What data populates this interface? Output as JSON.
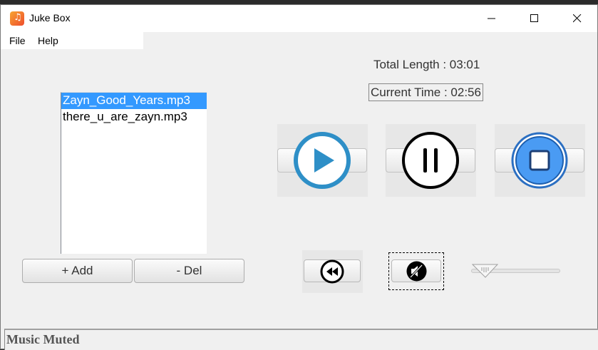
{
  "window": {
    "title": "Juke Box",
    "minimize_icon": "minimize-icon",
    "maximize_icon": "maximize-icon",
    "close_icon": "close-icon"
  },
  "menu": {
    "items": [
      {
        "label": "File"
      },
      {
        "label": "Help"
      }
    ]
  },
  "playlist": {
    "items": [
      {
        "label": "Zayn_Good_Years.mp3",
        "selected": true
      },
      {
        "label": "there_u_are_zayn.mp3",
        "selected": false
      }
    ]
  },
  "buttons": {
    "add": "+ Add",
    "delete": "- Del"
  },
  "info": {
    "total_length": "Total Length : 03:01",
    "current_time": "Current Time : 02:56"
  },
  "controls": {
    "play_icon": "play-icon",
    "pause_icon": "pause-icon",
    "stop_icon": "stop-icon",
    "rewind_icon": "rewind-icon",
    "mute_icon": "mute-icon",
    "volume_level": 0.0
  },
  "status": {
    "text": "Music Muted"
  },
  "colors": {
    "accent": "#2e8fc7",
    "selection": "#3399ff",
    "stop": "#4a9bf3"
  }
}
